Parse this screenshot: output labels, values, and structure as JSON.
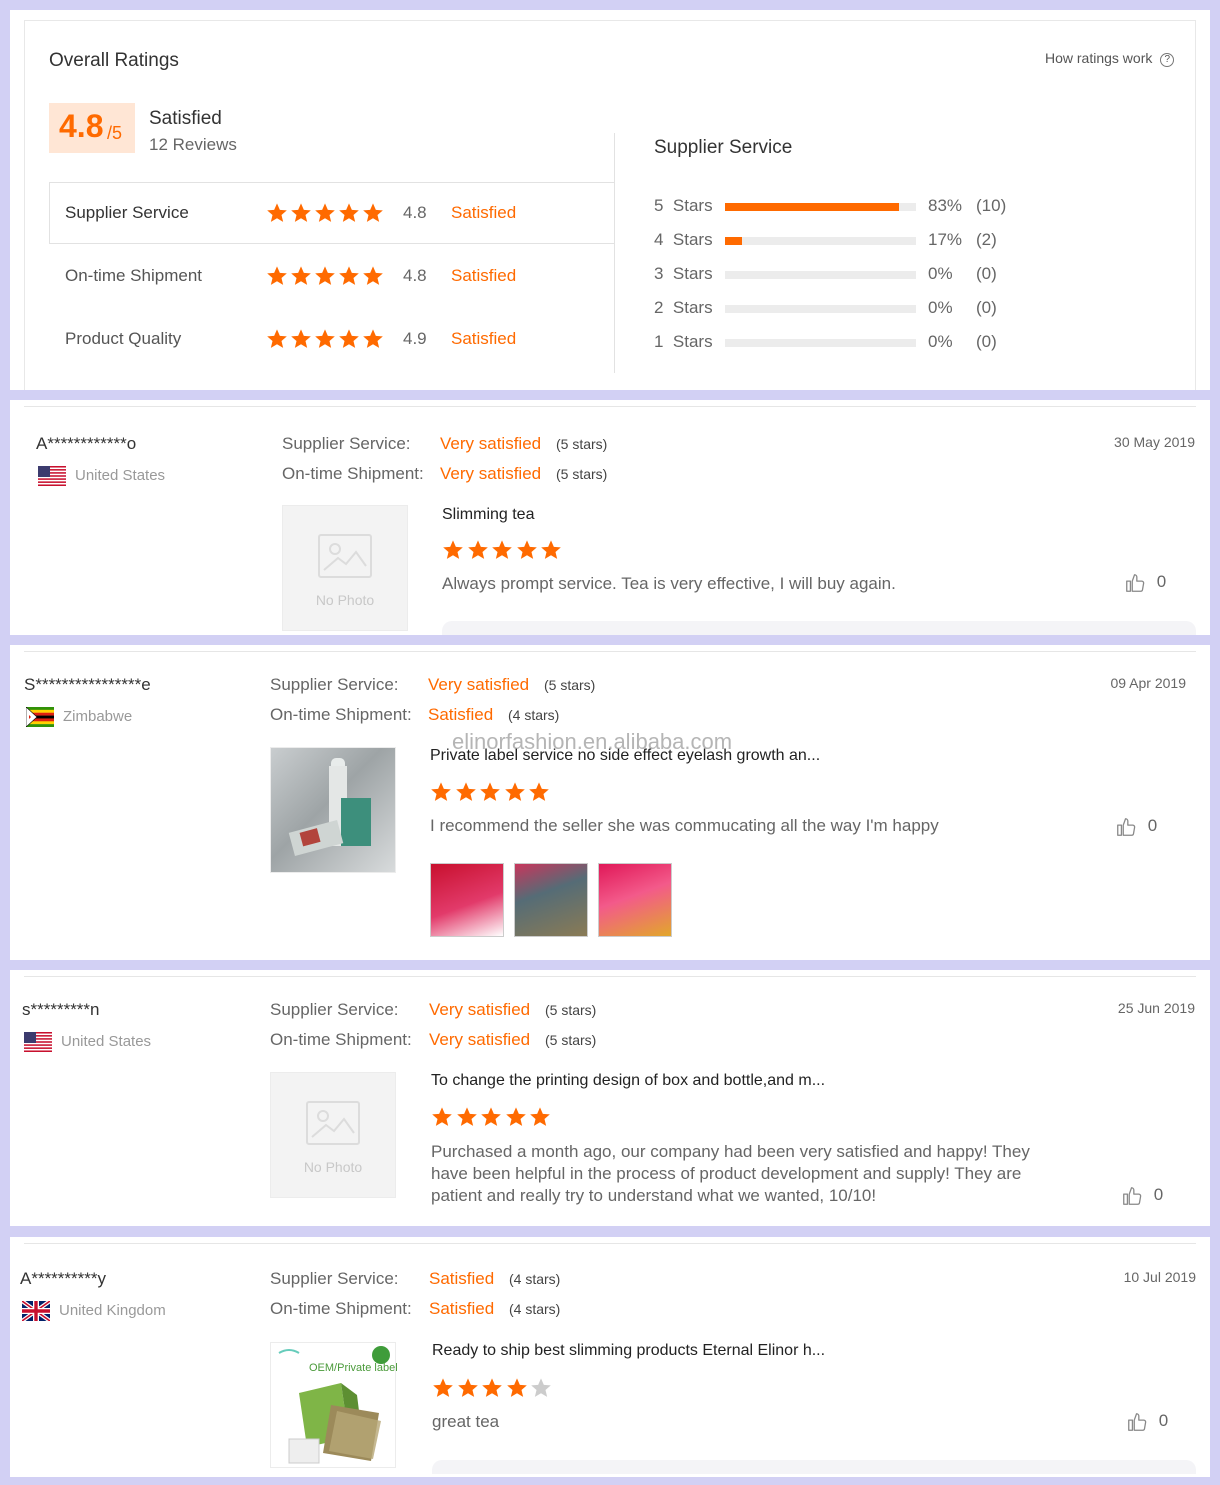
{
  "overall": {
    "title": "Overall Ratings",
    "how_link": "How ratings work",
    "score": "4.8",
    "score_suffix": "/5",
    "label": "Satisfied",
    "reviews": "12 Reviews",
    "categories": [
      {
        "name": "Supplier Service",
        "score": "4.8",
        "label": "Satisfied"
      },
      {
        "name": "On-time Shipment",
        "score": "4.8",
        "label": "Satisfied"
      },
      {
        "name": "Product Quality",
        "score": "4.9",
        "label": "Satisfied"
      }
    ],
    "breakdown_title": "Supplier Service",
    "breakdown": [
      {
        "label": "5  Stars",
        "pct": "83%",
        "count": "(10)",
        "fill": 0.91
      },
      {
        "label": "4  Stars",
        "pct": "17%",
        "count": "(2)",
        "fill": 0.09
      },
      {
        "label": "3  Stars",
        "pct": "0%",
        "count": "(0)",
        "fill": 0
      },
      {
        "label": "2  Stars",
        "pct": "0%",
        "count": "(0)",
        "fill": 0
      },
      {
        "label": "1  Stars",
        "pct": "0%",
        "count": "(0)",
        "fill": 0
      }
    ]
  },
  "labels": {
    "supplier_service": "Supplier Service:",
    "ontime_shipment": "On-time Shipment:",
    "no_photo": "No Photo"
  },
  "reviews": [
    {
      "user": "A************o",
      "country": "United States",
      "flag": "us",
      "date": "30 May 2019",
      "supplier_rating": "Very satisfied",
      "supplier_stars": "(5 stars)",
      "shipment_rating": "Very satisfied",
      "shipment_stars": "(5 stars)",
      "product": "Slimming tea",
      "stars": 5,
      "text": "Always prompt service. Tea is very effective, I will buy again.",
      "likes": "0"
    },
    {
      "user": "S****************e",
      "country": "Zimbabwe",
      "flag": "zw",
      "date": "09 Apr 2019",
      "supplier_rating": "Very satisfied",
      "supplier_stars": "(5 stars)",
      "shipment_rating": "Satisfied",
      "shipment_stars": "(4 stars)",
      "product": "Private label service no side effect eyelash growth an...",
      "watermark": "elinorfashion.en.alibaba.com",
      "stars": 5,
      "text": "I recommend the seller she was commucating all the way I'm happy",
      "likes": "0"
    },
    {
      "user": "s*********n",
      "country": "United States",
      "flag": "us",
      "date": "25 Jun 2019",
      "supplier_rating": "Very satisfied",
      "supplier_stars": "(5 stars)",
      "shipment_rating": "Very satisfied",
      "shipment_stars": "(5 stars)",
      "product": "To change the printing design of box and bottle,and m...",
      "stars": 5,
      "text_lines": [
        "Purchased a month ago, our company had been very satisfied and happy! They",
        "have been helpful in the process of product development and supply! They are",
        "patient and really try to understand what we wanted, 10/10!"
      ],
      "likes": "0"
    },
    {
      "user": "A**********y",
      "country": "United Kingdom",
      "flag": "uk",
      "date": "10 Jul 2019",
      "supplier_rating": "Satisfied",
      "supplier_stars": "(4 stars)",
      "shipment_rating": "Satisfied",
      "shipment_stars": "(4 stars)",
      "product": "Ready to ship best slimming products Eternal Elinor h...",
      "product_image_text": "OEM/Private label",
      "stars": 4,
      "text": "great tea",
      "likes": "0"
    }
  ],
  "colors": {
    "accent": "#ff6a00",
    "star_off": "#cccccc",
    "page_bg": "#d2d0f4"
  }
}
